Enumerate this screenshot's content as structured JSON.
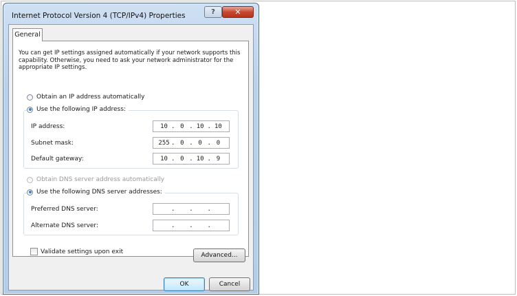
{
  "window": {
    "title": "Internet Protocol Version 4 (TCP/IPv4) Properties",
    "help_glyph": "?",
    "close_glyph": "✕"
  },
  "tabs": [
    {
      "label": "General"
    }
  ],
  "general": {
    "description": "You can get IP settings assigned automatically if your network supports this capability. Otherwise, you need to ask your network administrator for the appropriate IP settings.",
    "ip_auto_label": "Obtain an IP address automatically",
    "ip_manual_label": "Use the following IP address:",
    "ip_address_label": "IP address:",
    "ip_address": [
      "10",
      "0",
      "10",
      "10"
    ],
    "subnet_mask_label": "Subnet mask:",
    "subnet_mask": [
      "255",
      "0",
      "0",
      "0"
    ],
    "gateway_label": "Default gateway:",
    "gateway": [
      "10",
      "0",
      "10",
      "9"
    ],
    "dns_auto_label": "Obtain DNS server address automatically",
    "dns_manual_label": "Use the following DNS server addresses:",
    "preferred_dns_label": "Preferred DNS server:",
    "alternate_dns_label": "Alternate DNS server:",
    "validate_label": "Validate settings upon exit",
    "advanced_label": "Advanced..."
  },
  "footer": {
    "ok_label": "OK",
    "cancel_label": "Cancel"
  }
}
